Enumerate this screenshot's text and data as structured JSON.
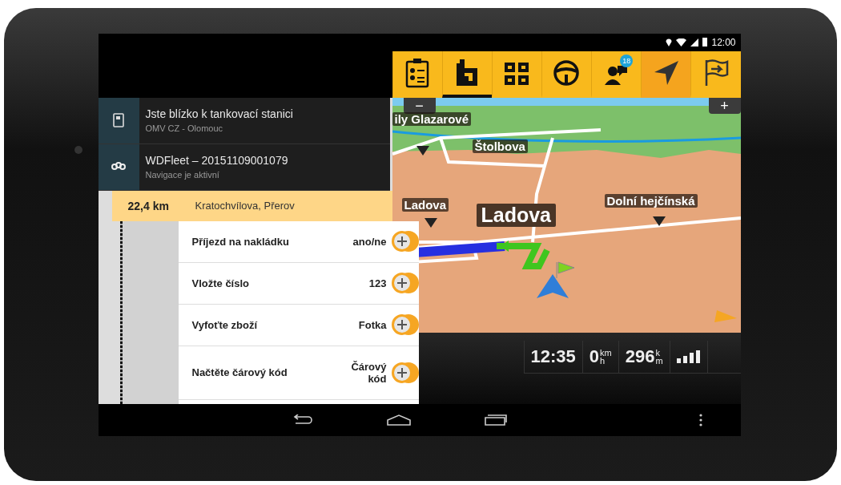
{
  "status_bar": {
    "time": "12:00"
  },
  "toolbar": {
    "tabs": [
      {
        "kind": "checklist",
        "selected": false,
        "active": false
      },
      {
        "kind": "route",
        "selected": true,
        "active": false
      },
      {
        "kind": "stops",
        "selected": false,
        "active": false
      },
      {
        "kind": "wheel",
        "selected": false,
        "active": false
      },
      {
        "kind": "messages",
        "selected": false,
        "active": false,
        "badge": "18"
      },
      {
        "kind": "navigate",
        "selected": false,
        "active": true
      },
      {
        "kind": "flag",
        "selected": false,
        "active": false
      }
    ]
  },
  "notifications": [
    {
      "kind": "fuel",
      "title": "Jste blízko k tankovací stanici",
      "subtitle": "OMV CZ - Olomouc"
    },
    {
      "kind": "app",
      "title": "WDFleet – 20151109001079",
      "subtitle": "Navigace je aktivní"
    }
  ],
  "route": {
    "distance": "22,4 km",
    "address": "Kratochvílova, Přerov"
  },
  "tasks": [
    {
      "label": "Příjezd na nakládku",
      "value": "ano/ne"
    },
    {
      "label": "Vložte číslo",
      "value": "123"
    },
    {
      "label": "Vyfoťte zboží",
      "value": "Fotka"
    },
    {
      "label": "Načtěte čárový kód",
      "value": "Čárový kód"
    }
  ],
  "map": {
    "zoom_out": "−",
    "zoom_in": "+",
    "labels": [
      {
        "text": "ily Glazarové",
        "kind": "street"
      },
      {
        "text": "Štolbova",
        "kind": "street"
      },
      {
        "text": "Ladova",
        "kind": "street"
      },
      {
        "text": "Ladova",
        "kind": "current"
      },
      {
        "text": "Dolní hejčínská",
        "kind": "street"
      }
    ]
  },
  "info_panel": {
    "time": "12:35",
    "speed": "0",
    "speed_unit_top": "km",
    "speed_unit_bottom": "h",
    "distance": "296",
    "distance_unit_top": "k",
    "distance_unit_bottom": "m"
  }
}
